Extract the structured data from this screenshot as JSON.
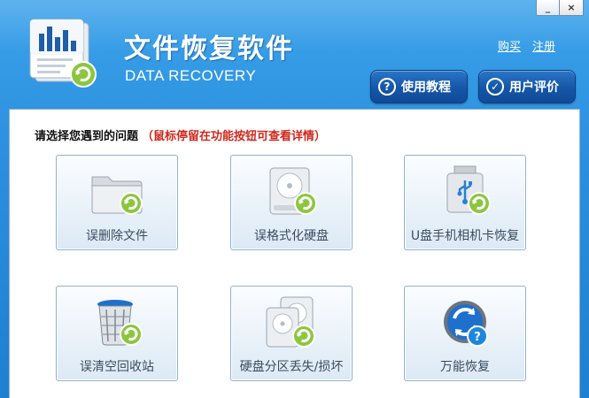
{
  "header": {
    "title": "文件恢复软件",
    "subtitle": "DATA RECOVERY",
    "links": {
      "buy": "购买",
      "register": "注册"
    },
    "buttons": {
      "guide": "使用教程",
      "review": "用户评价"
    }
  },
  "window_controls": {
    "minimize": "_",
    "close": "×"
  },
  "main": {
    "prompt": "请选择您遇到的问题",
    "hint": "（鼠标停留在功能按钮可查看详情）",
    "cards": [
      {
        "label": "误删除文件",
        "icon": "folder-recover-icon"
      },
      {
        "label": "误格式化硬盘",
        "icon": "harddisk-recover-icon"
      },
      {
        "label": "U盘手机相机卡恢复",
        "icon": "usb-drive-recover-icon"
      },
      {
        "label": "误清空回收站",
        "icon": "recycle-bin-recover-icon"
      },
      {
        "label": "硬盘分区丢失/损坏",
        "icon": "partition-recover-icon"
      },
      {
        "label": "万能恢复",
        "icon": "universal-recover-icon"
      }
    ]
  },
  "colors": {
    "header_blue": "#2c8fde",
    "button_blue": "#1556a8",
    "recover_green": "#8cc63f",
    "hint_red": "#d0281c"
  }
}
